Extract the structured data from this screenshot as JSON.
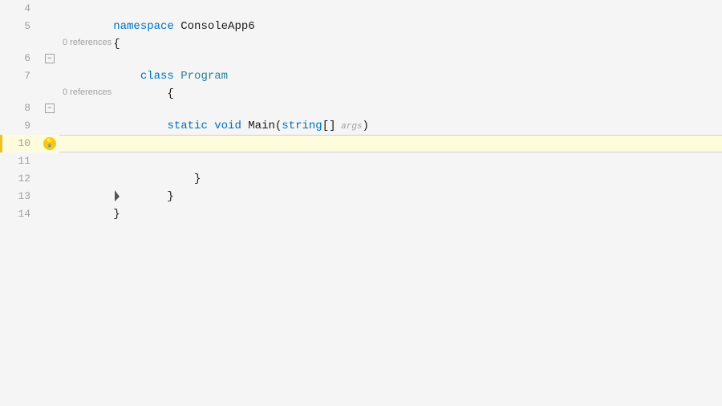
{
  "editor": {
    "background": "#f5f5f5",
    "lines": [
      {
        "num": "4",
        "gutter": "none",
        "indent": "",
        "tokens": [
          {
            "text": "namespace ",
            "class": "keyword"
          },
          {
            "text": "ConsoleApp6",
            "class": "plain"
          }
        ]
      },
      {
        "num": "5",
        "gutter": "none",
        "indent": "",
        "tokens": [
          {
            "text": "{",
            "class": "plain"
          }
        ]
      },
      {
        "num": "6",
        "gutter": "collapse",
        "indent": "    ",
        "tokens": [
          {
            "text": "class ",
            "class": "keyword"
          },
          {
            "text": "Program",
            "class": "class-name"
          }
        ],
        "hint": "0 references"
      },
      {
        "num": "7",
        "gutter": "none",
        "indent": "    ",
        "tokens": [
          {
            "text": "{",
            "class": "plain"
          }
        ]
      },
      {
        "num": "8",
        "gutter": "collapse",
        "indent": "        ",
        "tokens": [
          {
            "text": "static ",
            "class": "keyword"
          },
          {
            "text": "void ",
            "class": "keyword"
          },
          {
            "text": "Main",
            "class": "plain"
          },
          {
            "text": "(",
            "class": "plain"
          },
          {
            "text": "string",
            "class": "keyword"
          },
          {
            "text": "[]",
            "class": "plain"
          },
          {
            "text": " args",
            "class": "plain"
          },
          {
            "text": ")",
            "class": "plain"
          }
        ],
        "hint": "0 references"
      },
      {
        "num": "9",
        "gutter": "none",
        "indent": "        ",
        "tokens": [
          {
            "text": "{",
            "class": "plain"
          }
        ]
      },
      {
        "num": "10",
        "gutter": "bulb",
        "indent": "            ",
        "tokens": [],
        "highlight": true,
        "hasDivider": true
      },
      {
        "num": "11",
        "gutter": "none",
        "indent": "        ",
        "tokens": [
          {
            "text": "}",
            "class": "plain"
          }
        ]
      },
      {
        "num": "12",
        "gutter": "none",
        "indent": "    ",
        "tokens": [
          {
            "text": "}",
            "class": "plain"
          }
        ]
      },
      {
        "num": "13",
        "gutter": "none",
        "indent": "",
        "tokens": [
          {
            "text": "}",
            "class": "plain"
          }
        ]
      },
      {
        "num": "14",
        "gutter": "none",
        "indent": "",
        "tokens": []
      }
    ],
    "cursor": {
      "line": 10,
      "char": 12
    }
  },
  "labels": {
    "references_hint": "0 references",
    "keyword_namespace": "namespace",
    "identifier_consoleapp6": "ConsoleApp6",
    "keyword_class": "class",
    "class_program": "Program",
    "keyword_static": "static",
    "keyword_void": "void",
    "method_main": "Main",
    "keyword_string": "string",
    "param_args": "args"
  }
}
